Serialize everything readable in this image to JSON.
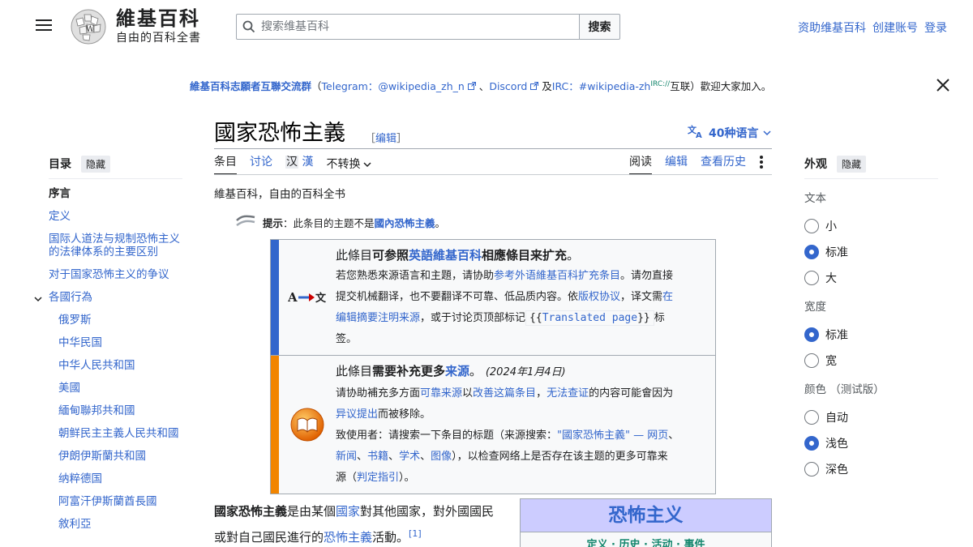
{
  "header": {
    "wordmark_title": "維基百科",
    "wordmark_tagline": "自由的百科全書",
    "search_placeholder": "搜索维基百科",
    "search_button": "搜索",
    "user_links": [
      "资助维基百科",
      "创建账号",
      "登录"
    ]
  },
  "notice": {
    "group": "維基百科志願者互聯交流群",
    "open_paren": "（",
    "telegram_label": "Telegram：",
    "telegram_handle": "@wikipedia_zh_n",
    "sep1": "、",
    "discord": "Discord",
    "and_irc": "及",
    "irc_label": "IRC：",
    "irc_channel": "#wikipedia-zh",
    "irc_proto": "IRC://",
    "tail": "互联）歡迎大家加入。"
  },
  "article": {
    "title": "國家恐怖主義",
    "edit_open": "［",
    "edit_label": "编辑",
    "edit_close": "］",
    "languages": "40种语言",
    "tabs_left": [
      "条目",
      "讨论"
    ],
    "variant_a": "汉",
    "variant_b": "漢",
    "converter": "不转换",
    "tabs_right": [
      "阅读",
      "编辑",
      "查看历史"
    ],
    "site_sub": "維基百科，自由的百科全书"
  },
  "hatnote": {
    "label": "提示",
    "text": "：此条目的主题不是",
    "link": "國內恐怖主義",
    "end": "。"
  },
  "ambox_translate": {
    "lead_pre": "此條目",
    "lead_b1": "可参照",
    "lead_link": "英語維基百科",
    "lead_b2": "相應條目来扩充",
    "lead_end": "。",
    "l2_pre": "若您熟悉來源语言和主題，请协助",
    "l2_link": "参考外语維基百科扩充条目",
    "l2_end": "。请勿直接",
    "l3": "提交机械翻译，也不要翻译不可靠、低品质内容。依",
    "l3_link1": "版权协议",
    "l3_mid": "，译文需",
    "l3_link2": "在",
    "l4_link": "编辑摘要注明来源",
    "l4_mid": "，或于讨论页顶部标记",
    "code_open": "{{",
    "code_link": "Translated page",
    "code_close": "}}",
    "l4_end": "标",
    "l5": "签。"
  },
  "ambox_sources": {
    "lead_pre": "此條目",
    "lead_b": "需要补充更多",
    "lead_link": "来源",
    "lead_end": "。",
    "date": "(2024年1月4日)",
    "l2_pre": "请协助補充多方面",
    "l2_link1": "可靠来源",
    "l2_mid": "以",
    "l2_link2": "改善这篇条目",
    "l2_sep": "，",
    "l2_link3": "无法查证",
    "l2_end": "的内容可能會因为",
    "l3_link": "异议提出",
    "l3_end": "而被移除。",
    "l4_pre": "致使用者：请搜索一下条目的标题（来源搜索：",
    "l4_link": "\"國家恐怖主義\"",
    "l4_dash": " — ",
    "l4_web": "网页",
    "l4_sep": "、",
    "l5_news": "新闻",
    "l5_books": "书籍",
    "l5_scholar": "学术",
    "l5_images": "图像",
    "l5_end": "），以检查网络上是否存在该主题的更多可靠来",
    "l6_pre": "源（",
    "l6_link": "判定指引",
    "l6_end": "）。"
  },
  "lede": {
    "bold": "國家恐怖主義",
    "t1": "是由某個",
    "link1": "國家",
    "t2": "對其他國家，對外國國民或對自己國民進行的",
    "link2": "恐怖主義",
    "t3": "活動。",
    "ref": "[1]"
  },
  "infobox": {
    "title": "恐怖主义",
    "links": [
      "定义",
      "历史",
      "活动",
      "事件"
    ]
  },
  "toc": {
    "title": "目录",
    "hide": "隐藏",
    "items": [
      {
        "label": "序言"
      },
      {
        "label": "定义"
      },
      {
        "label": "国际人道法与规制恐怖主义的法律体系的主要区别"
      },
      {
        "label": "对于国家恐怖主义的争议"
      },
      {
        "label": "各國行為"
      },
      {
        "label": "俄罗斯"
      },
      {
        "label": "中华民国"
      },
      {
        "label": "中华人民共和国"
      },
      {
        "label": "美國"
      },
      {
        "label": "緬甸聯邦共和國"
      },
      {
        "label": "朝鲜民主主義人民共和國"
      },
      {
        "label": "伊朗伊斯蘭共和國"
      },
      {
        "label": "纳粹德国"
      },
      {
        "label": "阿富汗伊斯蘭酋長國"
      },
      {
        "label": "敘利亞"
      }
    ]
  },
  "appearance": {
    "title": "外观",
    "hide": "隐藏",
    "text_label": "文本",
    "text_options": [
      "小",
      "标准",
      "大"
    ],
    "text_selected": "标准",
    "width_label": "宽度",
    "width_options": [
      "标准",
      "宽"
    ],
    "width_selected": "标准",
    "color_label": "颜色 （测试版）",
    "color_options": [
      "自动",
      "浅色",
      "深色"
    ],
    "color_selected": "浅色"
  },
  "colors": {
    "link": "#3366cc",
    "ambox_translate_stripe": "#36c",
    "ambox_sources_stripe": "#f28500",
    "infobox_title_bg": "#ccccff"
  },
  "icons": [
    "menu-icon",
    "wikipedia-globe-icon",
    "search-icon",
    "close-icon",
    "translate-icon",
    "chevron-down-icon",
    "more-icon",
    "disambig-icon",
    "translate-arrow-icon",
    "book-icon",
    "external-link-icon"
  ]
}
